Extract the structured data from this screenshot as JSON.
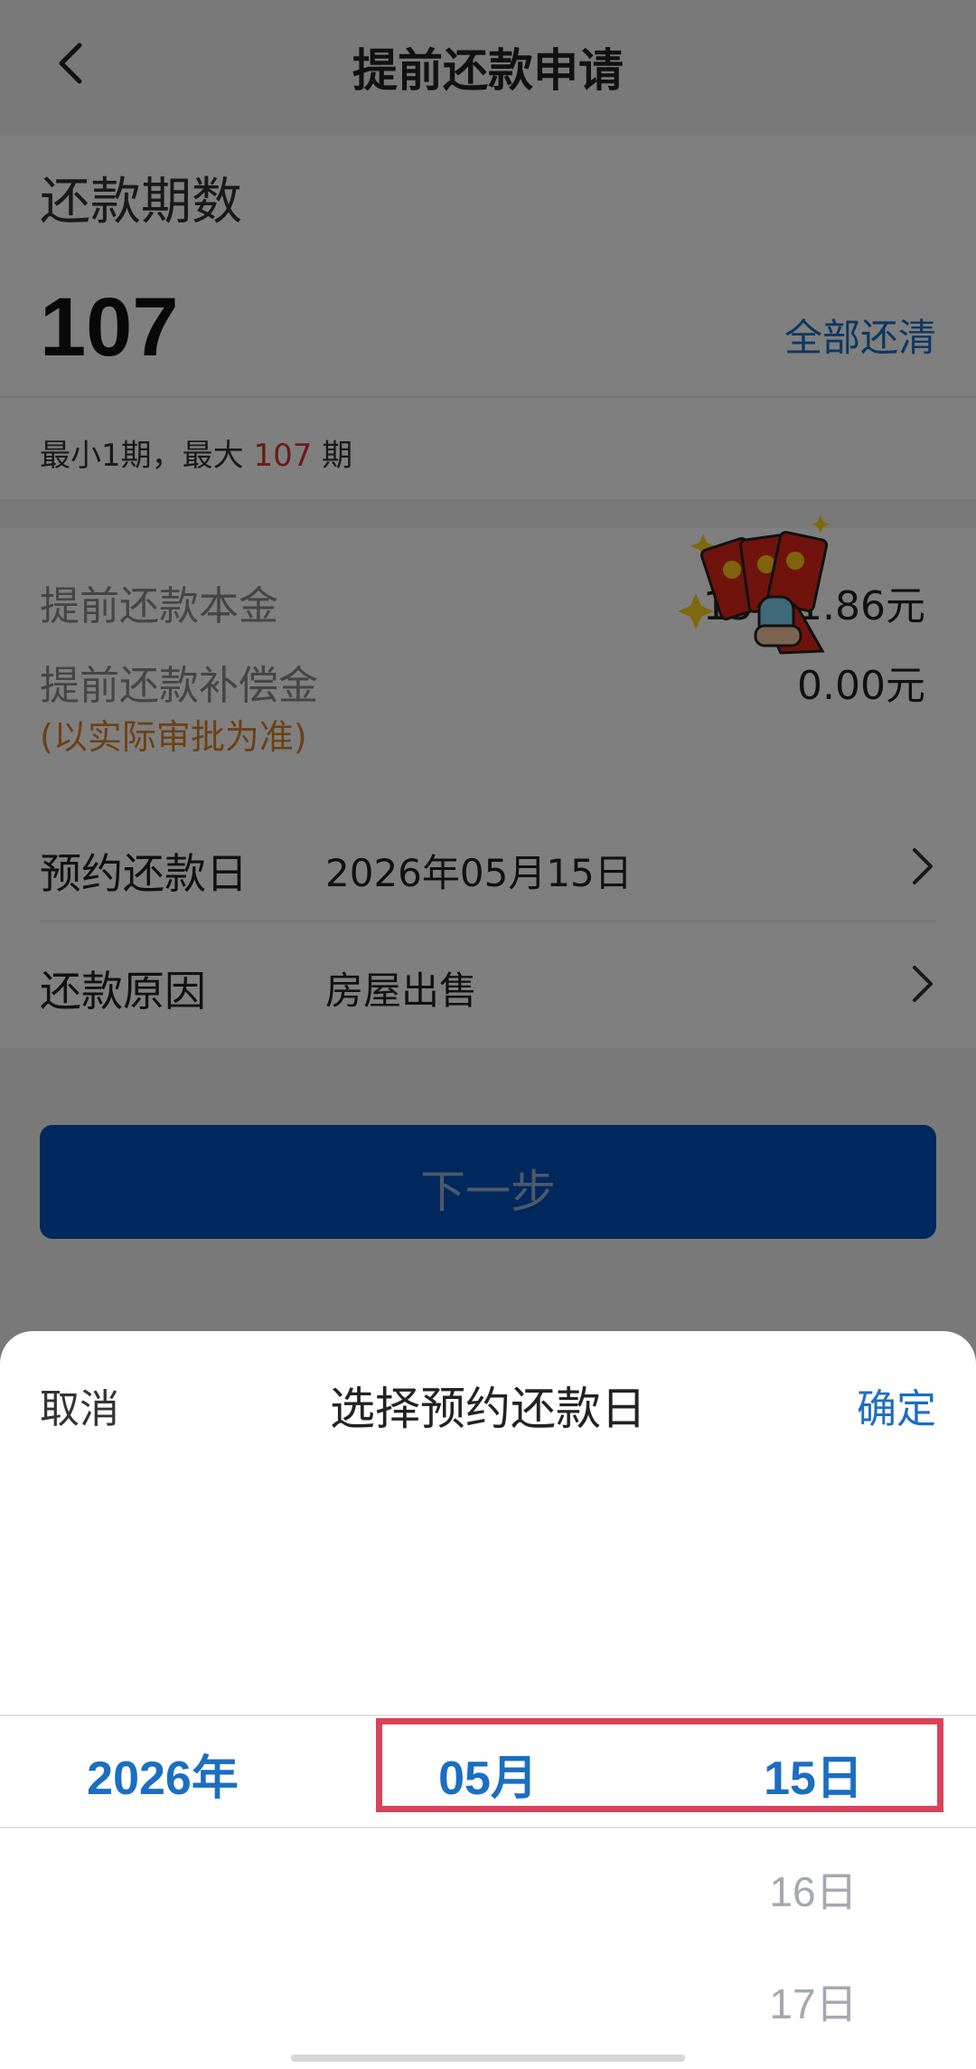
{
  "header": {
    "title": "提前还款申请",
    "back_icon": "chevron-left-icon"
  },
  "periods": {
    "label": "还款期数",
    "value": "107",
    "repay_all_label": "全部还清",
    "range_prefix": "最小1期，最大",
    "range_max": "107",
    "range_suffix": "期"
  },
  "amounts": {
    "principal_label": "提前还款本金",
    "principal_value": "15(  )1.86元",
    "compensation_label": "提前还款补偿金",
    "compensation_value": "0.00元",
    "compensation_note": "(以实际审批为准)"
  },
  "rows": {
    "date_label": "预约还款日",
    "date_value": "2026年05月15日",
    "reason_label": "还款原因",
    "reason_value": "房屋出售"
  },
  "next_button": {
    "label": "下一步"
  },
  "sheet": {
    "cancel_label": "取消",
    "title": "选择预约还款日",
    "confirm_label": "确定",
    "picker": {
      "year_selected": "2026年",
      "month_selected": "05月",
      "day_selected": "15日",
      "day_next1": "16日",
      "day_next2": "17日"
    }
  },
  "colors": {
    "accent_blue": "#1b6ec2",
    "button_blue": "#0050b8",
    "range_red": "#d6362f",
    "note_orange": "#d9822b",
    "highlight_red": "#d9435a"
  }
}
